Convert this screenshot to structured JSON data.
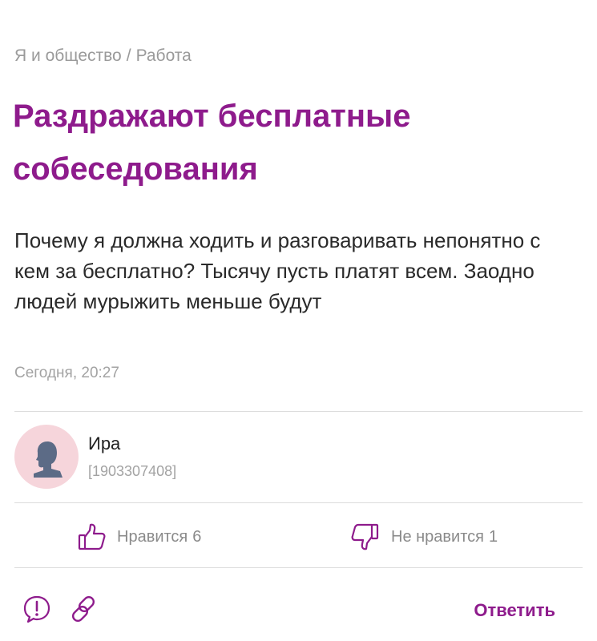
{
  "breadcrumb": {
    "category": "Я и общество",
    "separator": "/",
    "subcategory": "Работа"
  },
  "post": {
    "title": "Раздражают бесплатные собеседования",
    "body": "Почему я должна ходить и разговаривать непонятно с кем за бесплатно? Тысячу пусть платят всем. Заодно людей мурыжить меньше будут",
    "timestamp": "Сегодня, 20:27"
  },
  "author": {
    "name": "Ира",
    "id": "[1903307408]"
  },
  "reactions": {
    "like_label": "Нравится",
    "like_count": "6",
    "dislike_label": "Не нравится",
    "dislike_count": "1"
  },
  "actions": {
    "report_icon": "exclamation-circle-icon",
    "link_icon": "link-icon",
    "reply_label": "Ответить"
  },
  "colors": {
    "accent": "#8e1b8c",
    "muted": "#9a9a9a",
    "avatar_bg": "#f6d5db",
    "avatar_fg": "#5c6b86"
  }
}
